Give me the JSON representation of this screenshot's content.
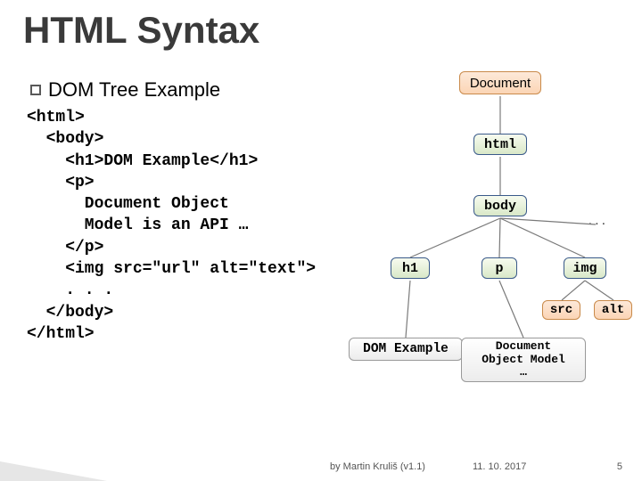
{
  "title": "HTML Syntax",
  "bullet": "DOM Tree Example",
  "code": "<html>\n  <body>\n    <h1>DOM Example</h1>\n    <p>\n      Document Object\n      Model is an API …\n    </p>\n    <img src=\"url\" alt=\"text\">\n    . . .\n  </body>\n</html>",
  "nodes": {
    "document": "Document",
    "html": "html",
    "body": "body",
    "h1": "h1",
    "p": "p",
    "img": "img",
    "src": "src",
    "alt": "alt",
    "dom_example": "DOM Example",
    "dom_text": "Document\nObject Model\n…"
  },
  "ellipsis": ". . .",
  "footer": {
    "by": "by Martin Kruliš (v1.1)",
    "date": "11. 10. 2017",
    "page": "5"
  }
}
